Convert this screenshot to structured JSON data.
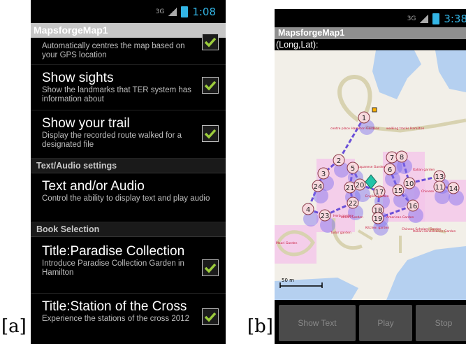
{
  "labels": {
    "a": "[a]",
    "b": "[b]"
  },
  "phone_a": {
    "status": {
      "network": "3G",
      "time": "1:08"
    },
    "title": "MapsforgeMap1",
    "prefs": [
      {
        "title": "",
        "summary": "Automatically centres the map based on your GPS location",
        "checked": true
      },
      {
        "title": "Show sights",
        "summary": "Show the landmarks that TER system has information about",
        "checked": true
      },
      {
        "title": "Show your trail",
        "summary": "Display the recorded route walked for a designated file",
        "checked": true
      }
    ],
    "cat_text_audio": "Text/Audio settings",
    "pref_text_audio": {
      "title": "Text and/or Audio",
      "summary": "Control the ability to display text and play audio"
    },
    "cat_book": "Book Selection",
    "books": [
      {
        "title": "Title:Paradise Collection",
        "summary": "Introduce Paradise Collection Garden in Hamilton",
        "checked": true
      },
      {
        "title": "Title:Station of the Cross",
        "summary": "Experience the stations of the cross 2012",
        "checked": true
      }
    ]
  },
  "phone_b": {
    "status": {
      "network": "3G",
      "time": "3:38"
    },
    "title": "MapsforgeMap1",
    "subtitle": "(Long,Lat):",
    "map": {
      "scale": "50 m",
      "place_labels": [
        "centre place Hamilton Gardens",
        "walking tracks Hamilton",
        "Japanese Garden",
        "English garden",
        "Chinese",
        "Maori Garden",
        "Indian Garden",
        "American Garden",
        "Italian garden",
        "Herb garden",
        "Kitchen garden",
        "Tudor garden",
        "Chinese Scholars Garden",
        "Italian Renaissance Garden"
      ],
      "markers": [
        {
          "n": "1"
        },
        {
          "n": "2"
        },
        {
          "n": "3"
        },
        {
          "n": "24"
        },
        {
          "n": "4"
        },
        {
          "n": "23"
        },
        {
          "n": "5"
        },
        {
          "n": "21"
        },
        {
          "n": "22"
        },
        {
          "n": "20"
        },
        {
          "n": "17"
        },
        {
          "n": "18"
        },
        {
          "n": "19"
        },
        {
          "n": "7"
        },
        {
          "n": "8"
        },
        {
          "n": "6"
        },
        {
          "n": "10"
        },
        {
          "n": "15"
        },
        {
          "n": "16"
        },
        {
          "n": "13"
        },
        {
          "n": "11"
        },
        {
          "n": "14"
        }
      ]
    },
    "buttons": {
      "show_text": "Show Text",
      "play": "Play",
      "stop": "Stop"
    }
  }
}
